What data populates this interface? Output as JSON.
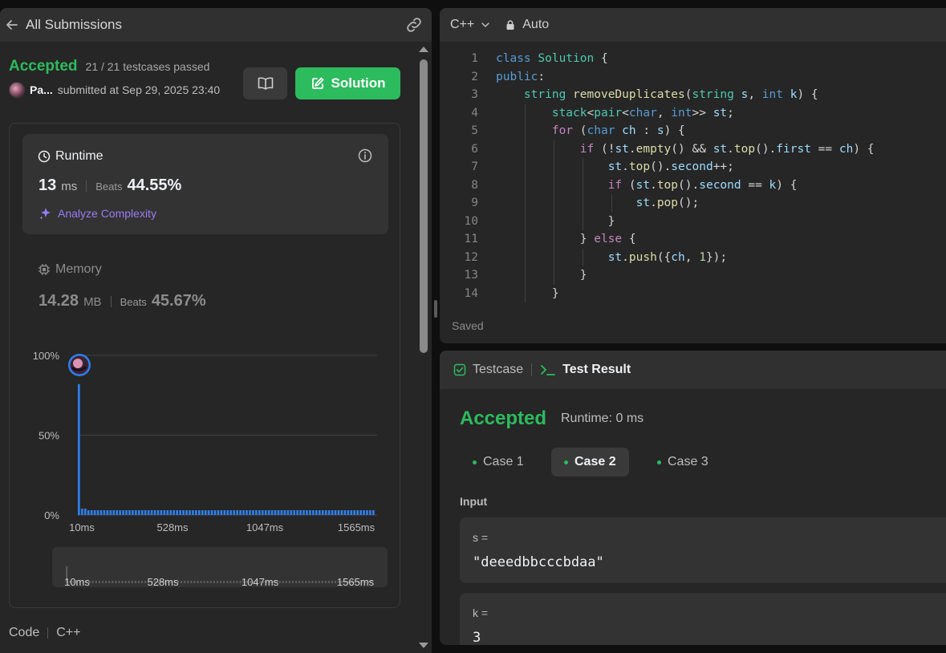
{
  "left": {
    "header_title": "All Submissions",
    "status": "Accepted",
    "testcases": "21 / 21 testcases passed",
    "user_name": "Pa...",
    "submitted_at": "submitted at Sep 29, 2025 23:40",
    "solution_label": "Solution",
    "runtime": {
      "title": "Runtime",
      "value": "13",
      "unit": "ms",
      "beats_label": "Beats",
      "beats": "44.55%",
      "analyze": "Analyze Complexity"
    },
    "memory": {
      "title": "Memory",
      "value": "14.28",
      "unit": "MB",
      "beats_label": "Beats",
      "beats": "45.67%"
    },
    "code_label": "Code",
    "code_lang": "C++"
  },
  "chart_data": {
    "type": "bar",
    "y_ticks": [
      "100%",
      "50%",
      "0%"
    ],
    "x_ticks": [
      "10ms",
      "528ms",
      "1047ms",
      "1565ms"
    ],
    "ylim": [
      0,
      100
    ],
    "values": [
      82,
      4,
      4,
      3,
      3,
      3,
      3,
      3,
      3,
      3,
      3,
      3,
      3,
      3,
      3,
      3,
      3,
      3,
      3,
      3,
      3,
      3,
      3,
      3,
      3,
      3,
      3,
      3,
      3,
      3,
      3,
      3,
      3,
      3,
      3,
      3,
      3,
      3,
      3,
      3,
      3,
      3,
      3,
      3,
      3,
      3,
      3,
      3,
      3,
      3,
      3,
      3,
      3,
      3,
      3,
      3,
      3,
      3,
      3,
      3,
      3,
      3,
      3,
      3,
      3,
      3,
      3,
      3,
      3,
      3,
      3,
      3,
      3,
      3,
      3,
      3,
      3,
      3,
      3,
      3,
      3,
      3,
      3,
      3,
      3,
      3,
      3,
      3,
      3,
      3,
      3,
      3,
      3,
      3
    ],
    "accent": "#2f80ed"
  },
  "editor": {
    "language": "C++",
    "mode": "Auto",
    "saved": "Saved",
    "line_numbers": [
      "1",
      "2",
      "3",
      "4",
      "5",
      "6",
      "7",
      "8",
      "9",
      "10",
      "11",
      "12",
      "13",
      "14"
    ]
  },
  "result": {
    "testcase_tab": "Testcase",
    "testresult_tab": "Test Result",
    "status": "Accepted",
    "runtime": "Runtime: 0 ms",
    "cases": [
      "Case 1",
      "Case 2",
      "Case 3"
    ],
    "active_case": "Case 2",
    "input_label": "Input",
    "s_label": "s =",
    "s_value": "\"deeedbbcccbdaa\"",
    "k_label": "k =",
    "k_value": "3"
  },
  "colors": {
    "accepted": "#2cbb5d",
    "bar": "#2f80ed",
    "analyze": "#9a7cf5"
  }
}
